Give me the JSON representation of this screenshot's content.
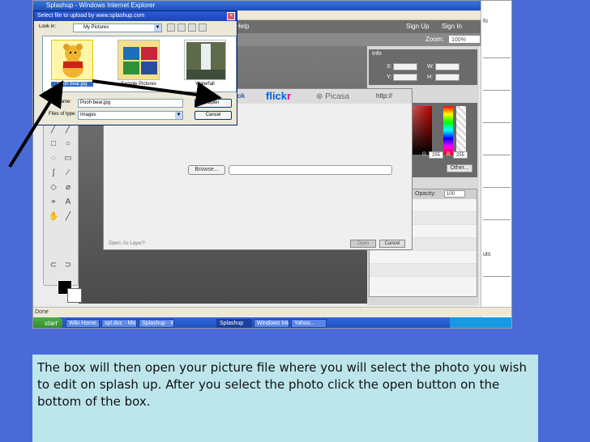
{
  "browser": {
    "title": "Splashup - Windows Internet Explorer",
    "status": "Done"
  },
  "splashup": {
    "menu_help": "Help",
    "sign_up": "Sign Up",
    "sign_in": "Sign In",
    "zoom_label": "Zoom:",
    "zoom_value": "100%",
    "info_title": "Info",
    "x_label": "X:",
    "y_label": "Y:",
    "w_label": "W:",
    "h_label": "H:",
    "g_label": "G:",
    "g_value": "255",
    "b_label": "B:",
    "b_value": "255",
    "other_button": "Other...",
    "opacity_label": "Opacity:",
    "opacity_value": "100",
    "side_text_1": "fo",
    "side_text_2": "uts"
  },
  "upload_dialog": {
    "tab_fragment": "ook",
    "flickr_a": "flick",
    "flickr_b": "r",
    "picasa": "Picasa",
    "http": "http://",
    "browse_button": "Browse...",
    "open_as_label": "Open: As Layer?",
    "open_button": "Open",
    "cancel_button": "Cancel"
  },
  "file_dialog": {
    "title": "Select file to upload by www.splashup.com",
    "look_in_label": "Look in:",
    "look_in_value": "My Pictures",
    "files": [
      {
        "name": "Pooh bear.jpg"
      },
      {
        "name": "Sample Pictures"
      },
      {
        "name": "Waterfall"
      }
    ],
    "file_name_label": "File name:",
    "file_name_value": "Pooh bear.jpg",
    "file_type_label": "Files of type:",
    "file_type_value": "Images",
    "open_button": "Open",
    "cancel_button": "Cancel"
  },
  "taskbar": {
    "start": "start",
    "items": [
      "Wiki Home...",
      "spl.doc - Microsoft Word",
      "Splashup - Windows ...",
      "Splashup",
      "Windows Inter...",
      "Yahoo..."
    ]
  },
  "caption": {
    "text": "The box will then open your picture file where you will select the photo you wish to edit on splash up. After you select the photo click the open button on the bottom of the box."
  }
}
